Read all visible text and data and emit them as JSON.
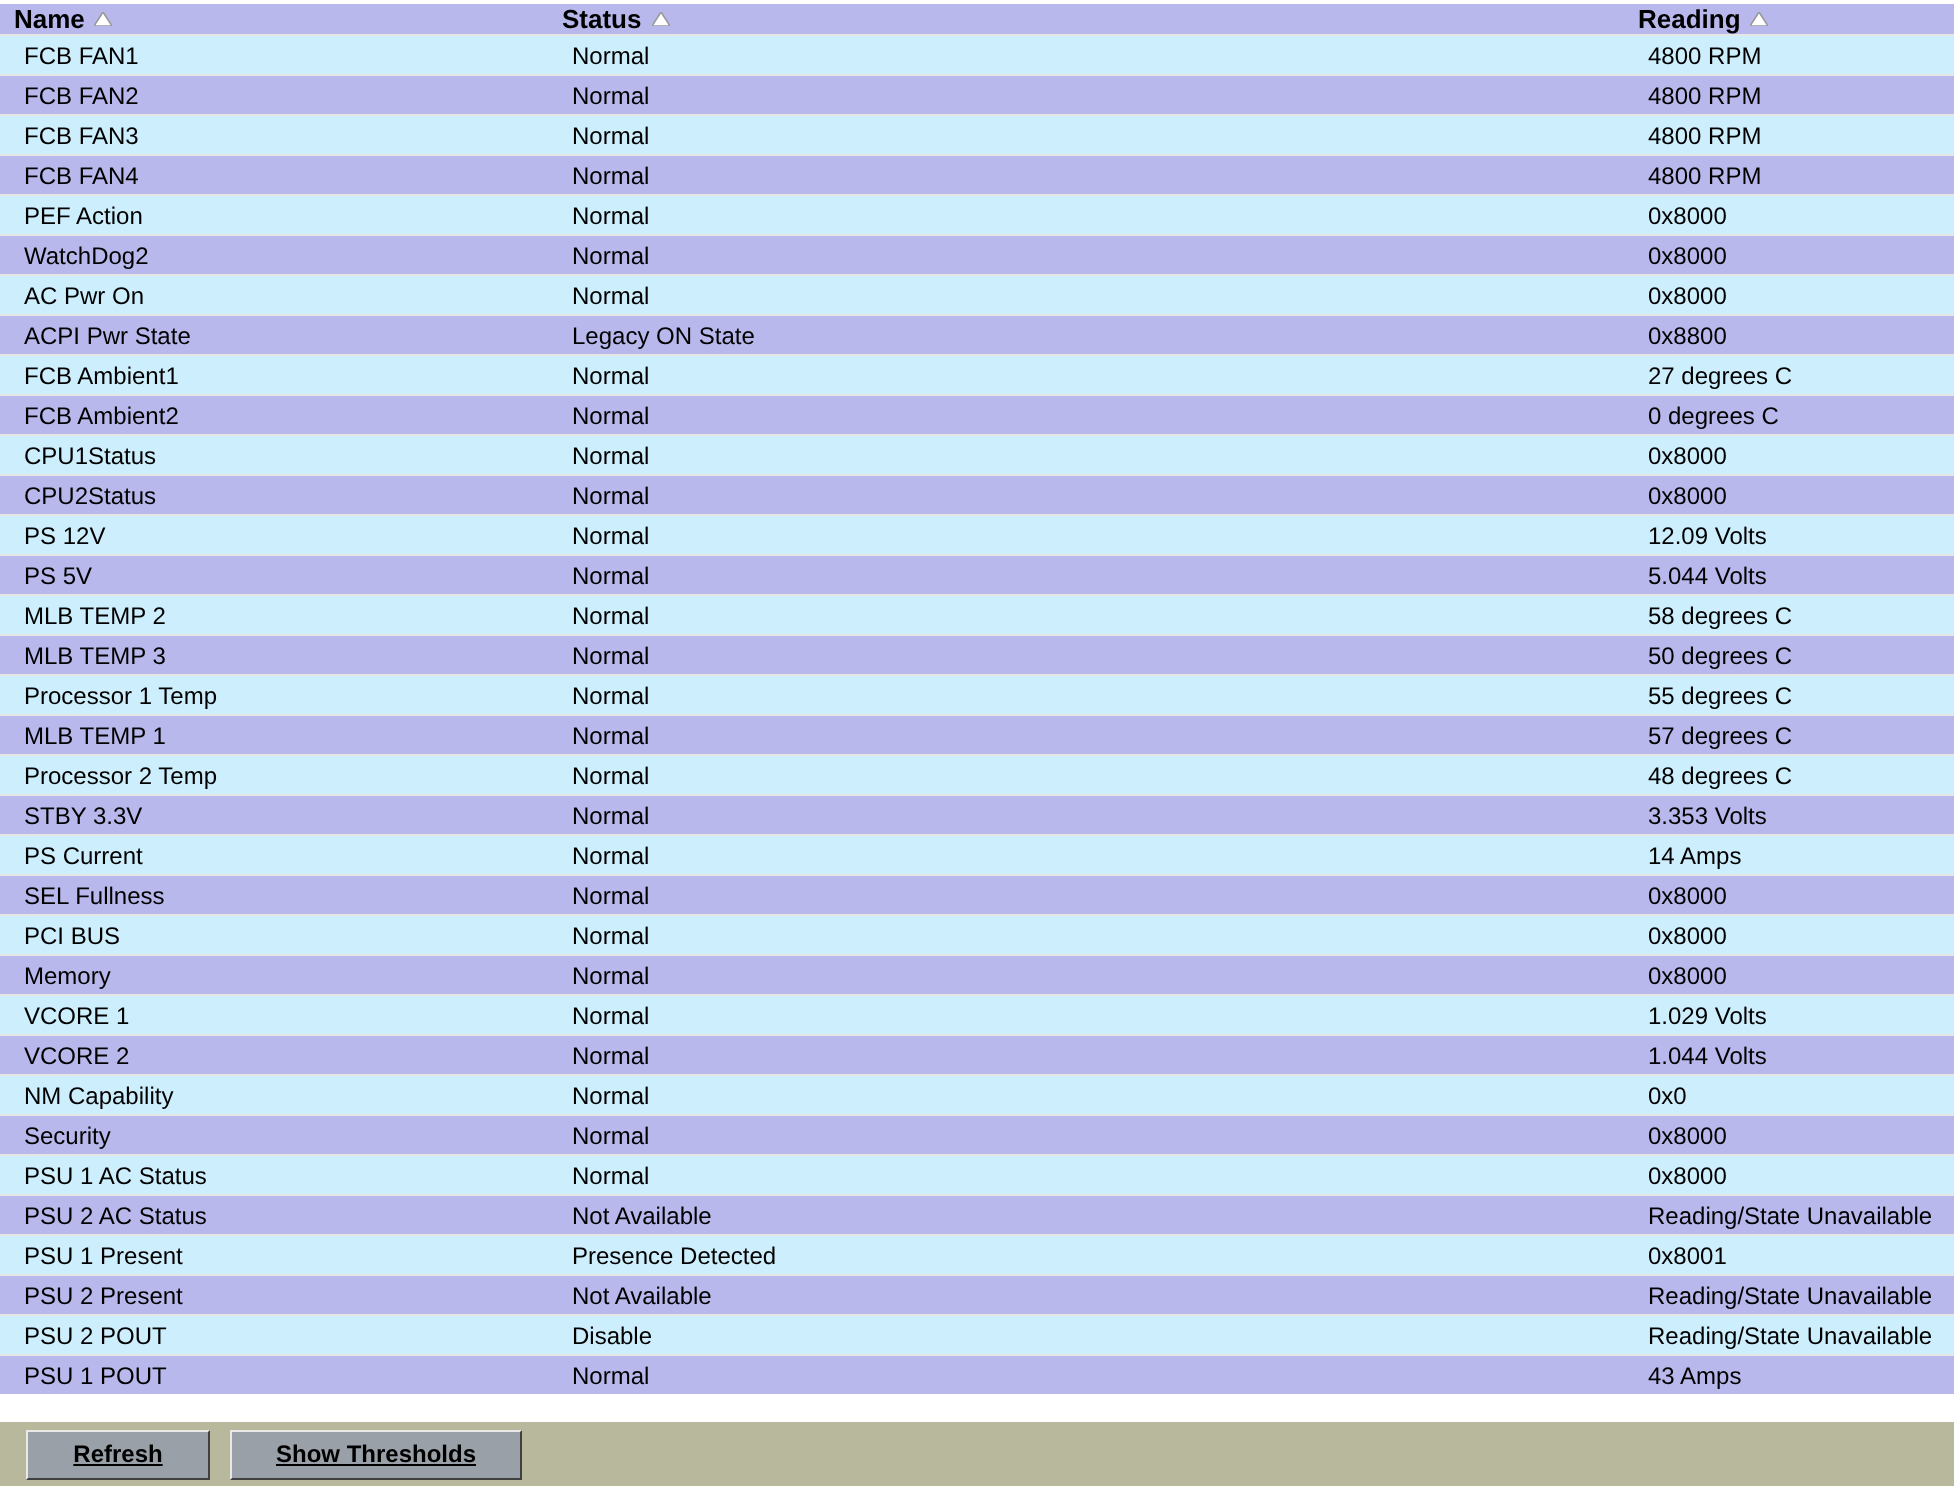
{
  "table": {
    "columns": [
      {
        "label": "Name",
        "sorted": true
      },
      {
        "label": "Status",
        "sorted": true
      },
      {
        "label": "Reading",
        "sorted": true
      }
    ],
    "rows": [
      [
        "FCB FAN1",
        "Normal",
        "4800 RPM"
      ],
      [
        "FCB FAN2",
        "Normal",
        "4800 RPM"
      ],
      [
        "FCB FAN3",
        "Normal",
        "4800 RPM"
      ],
      [
        "FCB FAN4",
        "Normal",
        "4800 RPM"
      ],
      [
        "PEF Action",
        "Normal",
        "0x8000"
      ],
      [
        "WatchDog2",
        "Normal",
        "0x8000"
      ],
      [
        "AC Pwr On",
        "Normal",
        "0x8000"
      ],
      [
        "ACPI Pwr State",
        "Legacy ON State",
        "0x8800"
      ],
      [
        "FCB Ambient1",
        "Normal",
        "27 degrees C"
      ],
      [
        "FCB Ambient2",
        "Normal",
        "0 degrees C"
      ],
      [
        "CPU1Status",
        "Normal",
        "0x8000"
      ],
      [
        "CPU2Status",
        "Normal",
        "0x8000"
      ],
      [
        "PS 12V",
        "Normal",
        "12.09 Volts"
      ],
      [
        "PS 5V",
        "Normal",
        "5.044 Volts"
      ],
      [
        "MLB TEMP 2",
        "Normal",
        "58 degrees C"
      ],
      [
        "MLB TEMP 3",
        "Normal",
        "50 degrees C"
      ],
      [
        "Processor 1 Temp",
        "Normal",
        "55 degrees C"
      ],
      [
        "MLB TEMP 1",
        "Normal",
        "57 degrees C"
      ],
      [
        "Processor 2 Temp",
        "Normal",
        "48 degrees C"
      ],
      [
        "STBY 3.3V",
        "Normal",
        "3.353 Volts"
      ],
      [
        "PS Current",
        "Normal",
        "14 Amps"
      ],
      [
        "SEL Fullness",
        "Normal",
        "0x8000"
      ],
      [
        "PCI BUS",
        "Normal",
        "0x8000"
      ],
      [
        "Memory",
        "Normal",
        "0x8000"
      ],
      [
        "VCORE 1",
        "Normal",
        "1.029 Volts"
      ],
      [
        "VCORE 2",
        "Normal",
        "1.044 Volts"
      ],
      [
        "NM Capability",
        "Normal",
        "0x0"
      ],
      [
        "Security",
        "Normal",
        "0x8000"
      ],
      [
        "PSU 1 AC Status",
        "Normal",
        "0x8000"
      ],
      [
        "PSU 2 AC Status",
        "Not Available",
        "Reading/State Unavailable"
      ],
      [
        "PSU 1 Present",
        "Presence Detected",
        "0x8001"
      ],
      [
        "PSU 2 Present",
        "Not Available",
        "Reading/State Unavailable"
      ],
      [
        "PSU 2 POUT",
        "Disable",
        "Reading/State Unavailable"
      ],
      [
        "PSU 1 POUT",
        "Normal",
        "43 Amps"
      ]
    ]
  },
  "buttons": [
    "Refresh",
    "Show Thresholds"
  ]
}
